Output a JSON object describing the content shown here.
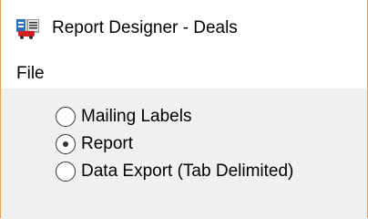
{
  "window": {
    "title": "Report Designer - Deals",
    "icon": "report-designer-app-icon",
    "accent_color": "#e8a04a"
  },
  "menubar": {
    "items": [
      {
        "label": "File"
      }
    ]
  },
  "options": {
    "items": [
      {
        "label": "Mailing Labels",
        "checked": false
      },
      {
        "label": "Report",
        "checked": true
      },
      {
        "label": "Data Export (Tab Delimited)",
        "checked": false
      }
    ]
  }
}
